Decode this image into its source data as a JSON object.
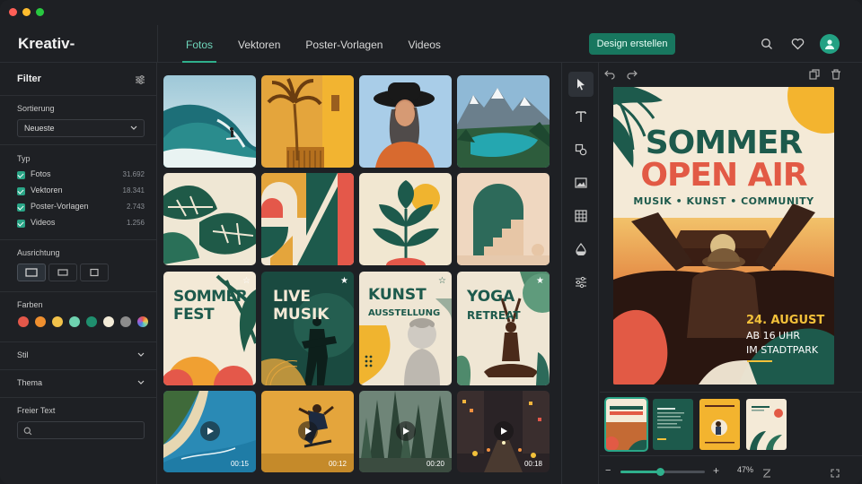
{
  "app": {
    "title": "Kreativ-Ressourcen"
  },
  "nav": {
    "tabs": [
      "Fotos",
      "Vektoren",
      "Poster-Vorlagen",
      "Videos"
    ],
    "active": "Fotos"
  },
  "header": {
    "cta_label": "Design erstellen"
  },
  "sidebar": {
    "title": "Filter",
    "sort": {
      "label": "Sortierung",
      "value": "Neueste"
    },
    "type": {
      "label": "Typ",
      "items": [
        {
          "label": "Fotos",
          "count": "31.692"
        },
        {
          "label": "Vektoren",
          "count": "18.341"
        },
        {
          "label": "Poster-Vorlagen",
          "count": "2.743"
        },
        {
          "label": "Videos",
          "count": "1.256"
        }
      ]
    },
    "orientation": {
      "label": "Ausrichtung",
      "selected": "landscape"
    },
    "colors": {
      "label": "Farben",
      "swatches": [
        "#e4584a",
        "#ef8f2f",
        "#f2c24a",
        "#6fd2b0",
        "#1f8f6e",
        "#f2ead7",
        "#8c8c8c",
        "multicolor"
      ]
    },
    "style_label": "Stil",
    "theme_label": "Thema",
    "freetext_label": "Freier Text"
  },
  "grid": {
    "posters": [
      {
        "line1": "SOMMER",
        "line2": "FEST"
      },
      {
        "line1": "LIVE",
        "line2": "MUSIK"
      },
      {
        "line1": "KUNST",
        "line2": "AUSSTELLUNG"
      },
      {
        "line1": "YOGA",
        "line2": "RETREAT"
      }
    ],
    "videos": [
      {
        "duration": "00:15"
      },
      {
        "duration": "00:12"
      },
      {
        "duration": "00:20"
      },
      {
        "duration": "00:18"
      }
    ]
  },
  "poster": {
    "line1": "SOMMER",
    "line2": "OPEN AIR",
    "tagline": "MUSIK • KUNST • COMMUNITY",
    "date": "24. AUGUST",
    "time": "AB 16 UHR",
    "place": "IM STADTPARK"
  },
  "zoom": {
    "level": "47%",
    "fraction": 0.47
  },
  "colors": {
    "accent": "#2fb08c",
    "cta": "#18775f",
    "poster_green": "#1d5a4c",
    "poster_red": "#e25a45",
    "poster_yellow": "#f3c13a"
  }
}
